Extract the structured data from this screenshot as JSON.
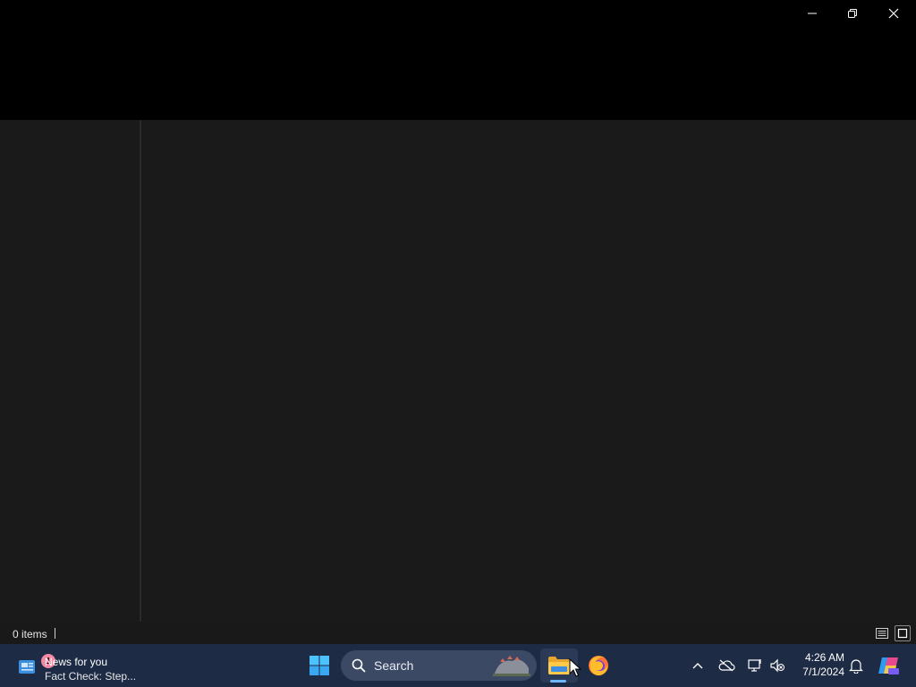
{
  "window": {
    "status": {
      "items_count": "0 items"
    },
    "caption_buttons": {
      "minimize_icon": "minimize-icon",
      "restore_icon": "restore-icon",
      "close_icon": "close-icon"
    }
  },
  "taskbar": {
    "news": {
      "badge": "1",
      "title": "News for you",
      "subtitle": "Fact Check: Step..."
    },
    "search": {
      "label": "Search"
    },
    "apps": [
      {
        "name": "File Explorer",
        "icon": "folder-icon",
        "active": true
      },
      {
        "name": "Firefox",
        "icon": "firefox-icon",
        "active": false
      }
    ],
    "clock": {
      "time": "4:26 AM",
      "date": "7/1/2024"
    }
  },
  "colors": {
    "titlebar": "#000000",
    "content": "#191919",
    "taskbar": "#1d2b45",
    "accent": "#6cb8ff"
  }
}
